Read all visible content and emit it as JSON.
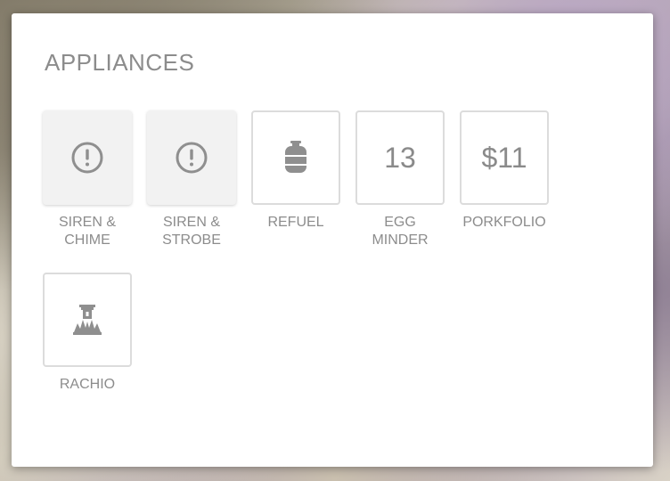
{
  "card": {
    "title": "APPLIANCES"
  },
  "tiles": [
    {
      "label": "SIREN &\nCHIME",
      "icon": "alert-circle-icon",
      "state": "alert"
    },
    {
      "label": "SIREN &\nSTROBE",
      "icon": "alert-circle-icon",
      "state": "alert"
    },
    {
      "label": "REFUEL",
      "icon": "propane-tank-icon",
      "state": "normal"
    },
    {
      "label": "EGG\nMINDER",
      "value": "13",
      "state": "normal"
    },
    {
      "label": "PORKFOLIO",
      "value": "$11",
      "state": "normal"
    },
    {
      "label": "RACHIO",
      "icon": "sprinkler-icon",
      "state": "normal"
    }
  ],
  "colors": {
    "icon_gray": "#8f8f8f",
    "text_gray": "#8c8c8c",
    "border_gray": "#dcdcdc",
    "alert_bg": "#f2f2f2"
  }
}
